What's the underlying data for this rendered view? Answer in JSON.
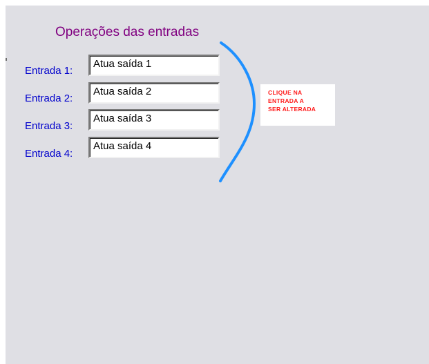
{
  "title": "Operações das entradas",
  "entries": [
    {
      "label": "Entrada 1:",
      "value": "Atua saída 1"
    },
    {
      "label": "Entrada 2:",
      "value": "Atua saída 2"
    },
    {
      "label": "Entrada 3:",
      "value": "Atua saída 3"
    },
    {
      "label": "Entrada 4:",
      "value": "Atua saída 4"
    }
  ],
  "note": {
    "line1": "CLIQUE NA",
    "line2": "ENTRADA A",
    "line3": "SER ALTERADA"
  },
  "colors": {
    "panel_bg": "#dfdfe4",
    "title": "#800080",
    "labels": "#0000cc",
    "note_text": "#ff1a1a",
    "brace": "#1e90ff"
  }
}
